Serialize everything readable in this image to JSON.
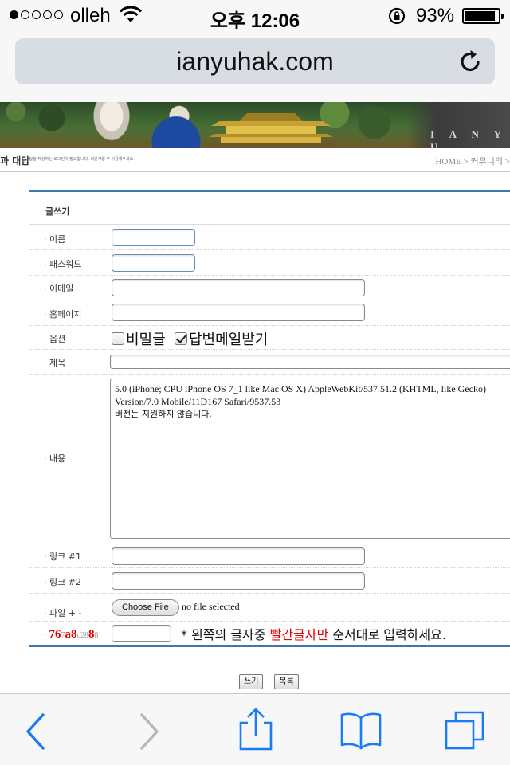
{
  "status_bar": {
    "carrier": "olleh",
    "time": "오후 12:06",
    "battery_percent": "93%",
    "battery_level": 0.93,
    "signal_bars": 1
  },
  "browser": {
    "url": "ianyuhak.com"
  },
  "banner": {
    "logo_text": "I A N Y U"
  },
  "section": {
    "title": "과 대답",
    "note": "*답을 작성하는 로그인이 필요합니다. 회원가입 후 사용해주세요.",
    "breadcrumb": "HOME > 커뮤니티 >"
  },
  "form": {
    "title": "글쓰기",
    "fields": {
      "name_label": "이름",
      "password_label": "패스워드",
      "email_label": "이메일",
      "homepage_label": "홈페이지",
      "option_label": "옵션",
      "subject_label": "제목",
      "content_label": "내용",
      "link1_label": "링크 #1",
      "link2_label": "링크 #2",
      "file_label": "파일 + -"
    },
    "options": {
      "secret_label": "비밀글",
      "secret_checked": false,
      "reply_mail_label": "답변메일받기",
      "reply_mail_checked": true
    },
    "content": {
      "line1": "5.0 (iPhone; CPU iPhone OS 7_1 like Mac OS X) AppleWebKit/537.51.2 (KHTML, like Gecko) Version/7.0 Mobile/11D167 Safari/9537.53",
      "line2": "버전는 지원하지 않습니다."
    },
    "file": {
      "button_label": "Choose File",
      "status": "no file selected"
    },
    "captcha": {
      "chars": [
        {
          "t": "7",
          "red": true
        },
        {
          "t": "6",
          "red": true
        },
        {
          "t": "7",
          "red": false
        },
        {
          "t": "a",
          "red": true
        },
        {
          "t": "8",
          "red": true
        },
        {
          "t": "c",
          "red": false
        },
        {
          "t": "2",
          "red": false
        },
        {
          "t": "8",
          "red": false
        },
        {
          "t": "8",
          "red": true
        },
        {
          "t": "8",
          "red": false
        }
      ],
      "help_prefix": "* 왼쪽의 글자중",
      "help_red": "빨간글자만",
      "help_suffix": "순서대로 입력하세요."
    },
    "write_button": "쓰기",
    "list_button": "목록"
  },
  "colors": {
    "accent_blue": "#3a79ad",
    "captcha_red": "#e00000",
    "ios_blue": "#1a7cf4"
  }
}
